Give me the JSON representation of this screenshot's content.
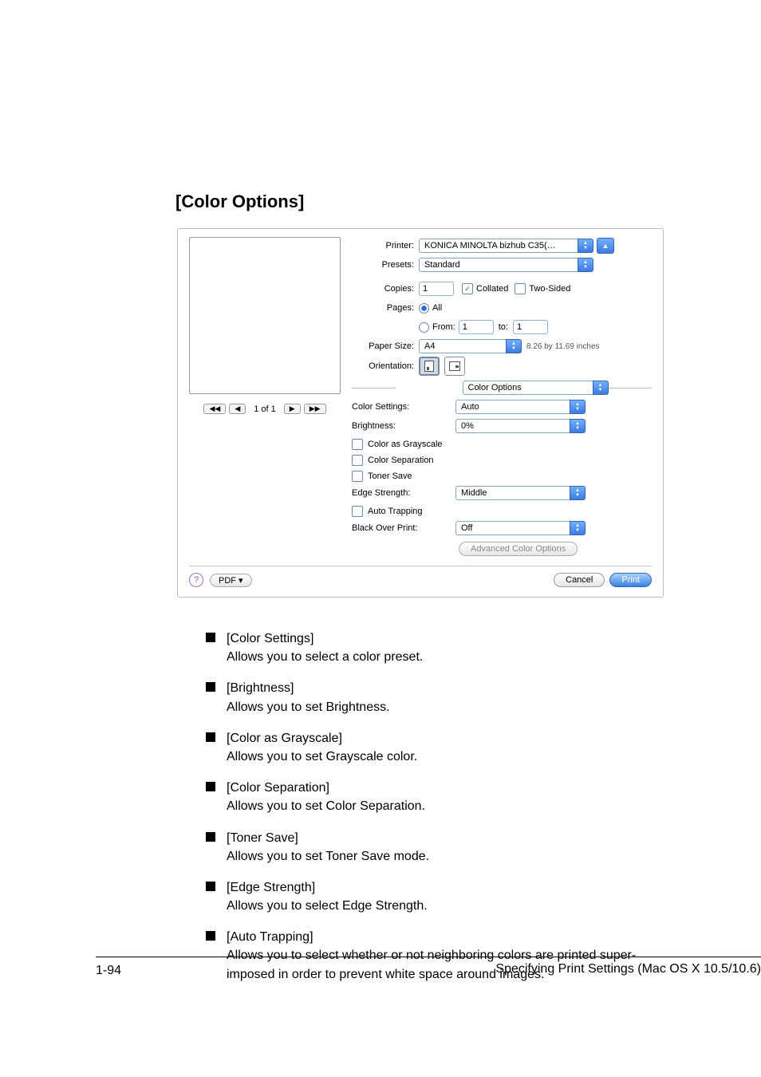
{
  "page": {
    "title": "[Color Options]",
    "number": "1-94",
    "footer": "Specifying Print Settings (Mac OS X 10.5/10.6)"
  },
  "dialog": {
    "labels": {
      "printer": "Printer:",
      "presets": "Presets:",
      "copies": "Copies:",
      "pages": "Pages:",
      "from": "From:",
      "to": "to:",
      "paper_size": "Paper Size:",
      "orientation": "Orientation:"
    },
    "printer": "KONICA MINOLTA bizhub C35(…",
    "presets": "Standard",
    "copies": "1",
    "collated": "Collated",
    "two_sided": "Two-Sided",
    "pages_all": "All",
    "pages_from": "1",
    "pages_to": "1",
    "paper_size": "A4",
    "paper_dims": "8.26 by 11.69 inches",
    "panel_name": "Color Options",
    "nav": {
      "indicator": "1 of 1"
    },
    "opts": {
      "labels": {
        "color_settings": "Color Settings:",
        "brightness": "Brightness:",
        "color_grayscale": "Color as Grayscale",
        "color_separation": "Color Separation",
        "toner_save": "Toner Save",
        "edge_strength": "Edge Strength:",
        "auto_trapping": "Auto Trapping",
        "black_over": "Black Over Print:"
      },
      "color_settings": "Auto",
      "brightness": "0%",
      "edge_strength": "Middle",
      "black_over": "Off",
      "advanced": "Advanced Color Options"
    },
    "buttons": {
      "pdf": "PDF ▾",
      "cancel": "Cancel",
      "print": "Print",
      "help": "?"
    }
  },
  "bullets": [
    {
      "title": "[Color Settings]",
      "body": "Allows you to select a color preset."
    },
    {
      "title": "[Brightness]",
      "body": "Allows you to set Brightness."
    },
    {
      "title": "[Color as Grayscale]",
      "body": "Allows you to set Grayscale color."
    },
    {
      "title": "[Color Separation]",
      "body": "Allows you to set Color Separation."
    },
    {
      "title": "[Toner Save]",
      "body": "Allows you to set Toner Save mode."
    },
    {
      "title": "[Edge Strength]",
      "body": "Allows you to select Edge Strength."
    },
    {
      "title": "[Auto Trapping]",
      "body": "Allows you to select whether or not neighboring colors are printed super-imposed in order to prevent white space around images."
    }
  ]
}
